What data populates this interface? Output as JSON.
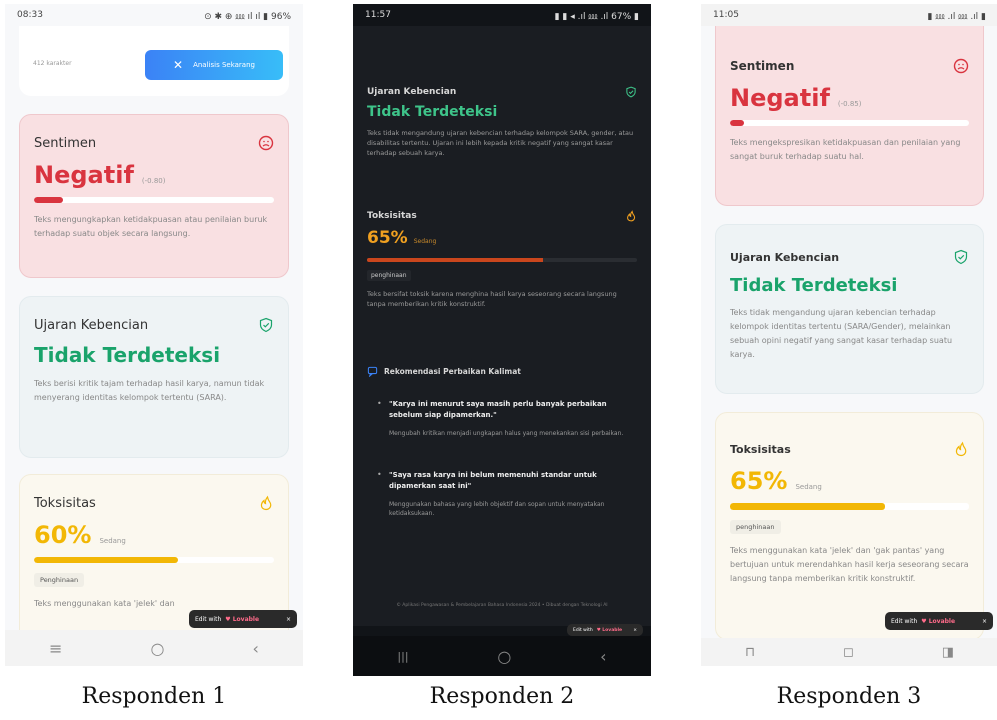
{
  "captions": [
    "Responden 1",
    "Responden 2",
    "Responden 3"
  ],
  "phone1": {
    "status_time": "08:33",
    "status_right": "⊙ ✱ ⊕ ⅏ ıl ıl ▮ 96%",
    "top_text": "412 karakter",
    "top_button": "Analisis Sekarang",
    "sentimen": {
      "title": "Sentimen",
      "value": "Negatif",
      "score": "(-0.80)",
      "progress": 0.12,
      "desc": "Teks mengungkapkan ketidakpuasan atau penilaian buruk terhadap suatu objek secara langsung."
    },
    "hate": {
      "title": "Ujaran Kebencian",
      "value": "Tidak Terdeteksi",
      "desc": "Teks berisi kritik tajam terhadap hasil karya, namun tidak menyerang identitas kelompok tertentu (SARA)."
    },
    "tox": {
      "title": "Toksisitas",
      "value": "60%",
      "level": "Sedang",
      "progress": 0.6,
      "chip": "Penghinaan",
      "desc": "Teks menggunakan kata 'jelek' dan"
    },
    "lovable": {
      "pre": "Edit with",
      "brand": "♥ Lovable",
      "close": "×"
    },
    "nav": [
      "≡",
      "○",
      "‹"
    ],
    "colors": {
      "negative": "#d9343f",
      "green": "#1aa36b",
      "amber": "#f2b705"
    }
  },
  "phone2": {
    "status_time": "11:57",
    "status_right": "▮ ▮ ◂ .ıl ⅏ .ıl 67% ▮",
    "hate": {
      "title": "Ujaran Kebencian",
      "value": "Tidak Terdeteksi",
      "desc": "Teks tidak mengandung ujaran kebencian terhadap kelompok SARA, gender, atau disabilitas tertentu. Ujaran ini lebih kepada kritik negatif yang sangat kasar terhadap sebuah karya."
    },
    "tox": {
      "title": "Toksisitas",
      "value": "65%",
      "level": "Sedang",
      "progress": 0.65,
      "chip": "penghinaan",
      "desc": "Teks bersifat toksik karena menghina hasil karya seseorang secara langsung tanpa memberikan kritik konstruktif."
    },
    "rec_title": "Rekomendasi Perbaikan Kalimat",
    "rec": [
      {
        "quote": "\"Karya ini menurut saya masih perlu banyak perbaikan sebelum siap dipamerkan.\"",
        "note": "Mengubah kritikan menjadi ungkapan halus yang menekankan sisi perbaikan."
      },
      {
        "quote": "\"Saya rasa karya ini belum memenuhi standar untuk dipamerkan saat ini\"",
        "note": "Menggunakan bahasa yang lebih objektif dan sopan untuk menyatakan ketidaksukaan."
      }
    ],
    "footer": "© Aplikasi Pengawasan & Pembelajaran Bahasa Indonesia 2024 • Dibuat dengan Teknologi AI",
    "lovable": {
      "pre": "Edit with",
      "brand": "♥ Lovable",
      "close": "×"
    },
    "nav": [
      "|||",
      "○",
      "‹"
    ],
    "colors": {
      "green": "#3ec48a",
      "amber": "#f0a020",
      "bar": "#c9461d"
    }
  },
  "phone3": {
    "status_time": "11:05",
    "status_right": "▮ ⅏ .ıl ⅏ .ıl ▮",
    "sentimen": {
      "title": "Sentimen",
      "value": "Negatif",
      "score": "(-0.85)",
      "progress": 0.06,
      "desc": "Teks mengekspresikan ketidakpuasan dan penilaian yang sangat buruk terhadap suatu hal."
    },
    "hate": {
      "title": "Ujaran Kebencian",
      "value": "Tidak Terdeteksi",
      "desc": "Teks tidak mengandung ujaran kebencian terhadap kelompok identitas tertentu (SARA/Gender), melainkan sebuah opini negatif yang sangat kasar terhadap suatu karya."
    },
    "tox": {
      "title": "Toksisitas",
      "value": "65%",
      "level": "Sedang",
      "progress": 0.65,
      "chip": "penghinaan",
      "desc": "Teks menggunakan kata 'jelek' dan 'gak pantas' yang bertujuan untuk merendahkan hasil kerja seseorang secara langsung tanpa memberikan kritik konstruktif."
    },
    "lovable": {
      "pre": "Edit with",
      "brand": "♥ Lovable",
      "close": "×"
    },
    "nav": [
      "⊓",
      "◻",
      "◨"
    ],
    "colors": {
      "negative": "#d9343f",
      "green": "#1aa36b",
      "amber": "#f2b705"
    }
  }
}
